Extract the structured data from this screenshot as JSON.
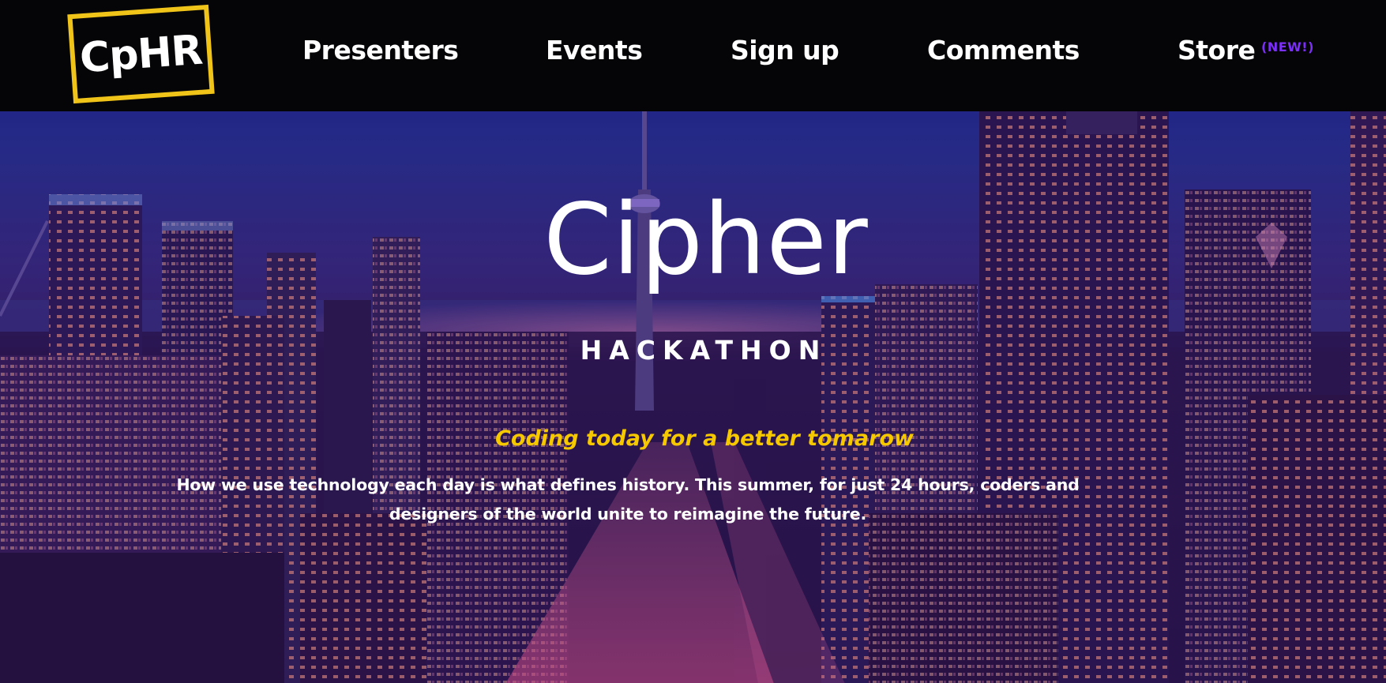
{
  "nav": {
    "logo": "CpHR",
    "items": [
      {
        "label": "Presenters"
      },
      {
        "label": "Events"
      },
      {
        "label": "Sign up"
      },
      {
        "label": "Comments"
      },
      {
        "label": "Store"
      }
    ],
    "store_badge": "(NEW!)"
  },
  "hero": {
    "title": "Cipher",
    "subtitle": "HACKATHON",
    "tagline": "Coding today for a better tomarow",
    "description": "How we use technology each day is what defines history. This summer, for just 24 hours, coders and designers of the world unite to reimagine the future."
  },
  "colors": {
    "logo_border": "#f0c419",
    "tagline": "#f5c800",
    "badge": "#7b2ff7",
    "navbar_bg": "#050507"
  }
}
